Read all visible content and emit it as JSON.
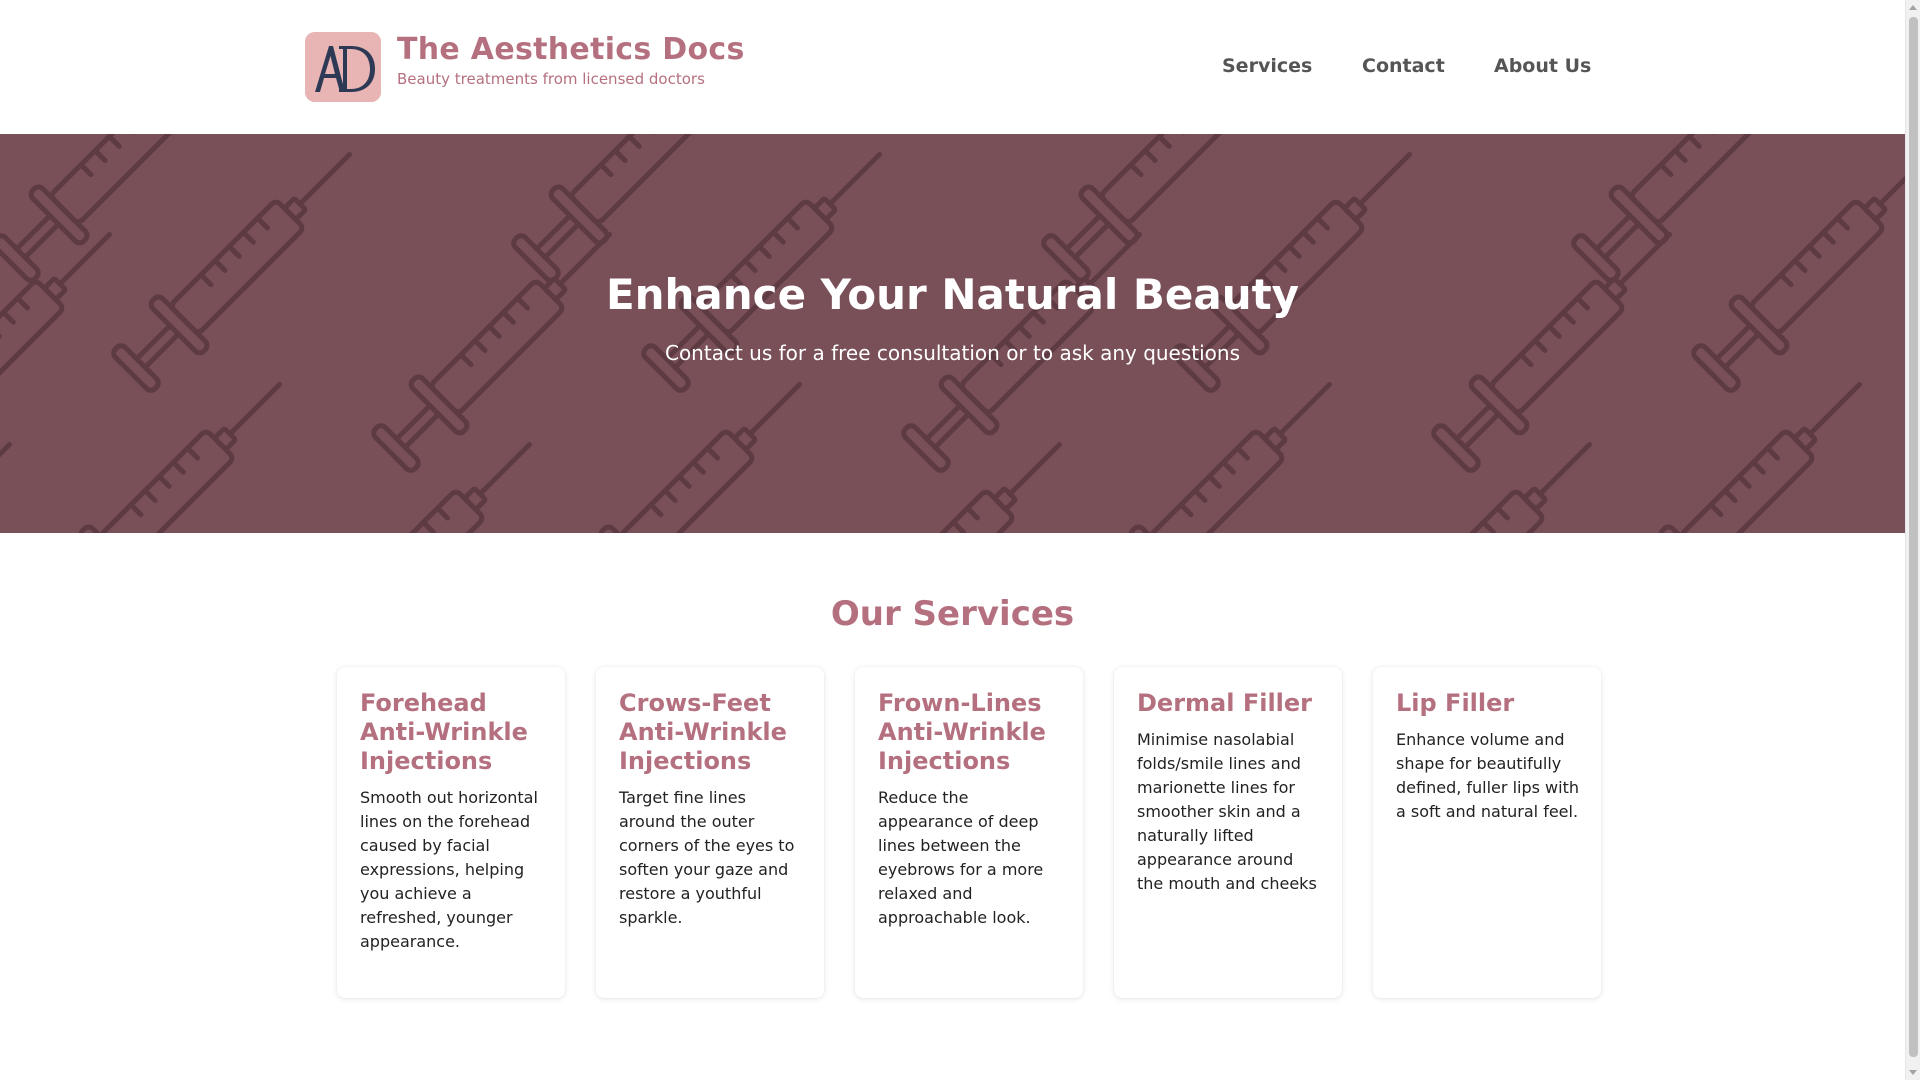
{
  "header": {
    "logo_icon": "ad-monogram-icon",
    "title": "The Aesthetics Docs",
    "subtitle": "Beauty treatments from licensed doctors",
    "nav": [
      {
        "label": "Services"
      },
      {
        "label": "Contact"
      },
      {
        "label": "About Us"
      }
    ]
  },
  "hero": {
    "title": "Enhance Your Natural Beauty",
    "subtitle": "Contact us for a free consultation or to ask any questions",
    "pattern_icon": "syringe-icon"
  },
  "services": {
    "title": "Our Services",
    "cards": [
      {
        "title": "Forehead Anti-Wrinkle Injections",
        "description": "Smooth out horizontal lines on the forehead caused by facial expressions, helping you achieve a refreshed, younger appearance."
      },
      {
        "title": "Crows-Feet Anti-Wrinkle Injections",
        "description": "Target fine lines around the outer corners of the eyes to soften your gaze and restore a youthful sparkle."
      },
      {
        "title": "Frown-Lines Anti-Wrinkle Injections",
        "description": "Reduce the appearance of deep lines between the eyebrows for a more relaxed and approachable look."
      },
      {
        "title": "Dermal Filler",
        "description": "Minimise nasolabial folds/smile lines and marionette lines for smoother skin and a naturally lifted appearance around the mouth and cheeks"
      },
      {
        "title": "Lip Filler",
        "description": "Enhance volume and shape for beautifully defined, fuller lips with a soft and natural feel."
      }
    ]
  },
  "colors": {
    "accent": "#b5707f",
    "hero_bg": "#794f58",
    "logo_bg": "#e8b4b4",
    "logo_letters": "#2e3a55"
  }
}
